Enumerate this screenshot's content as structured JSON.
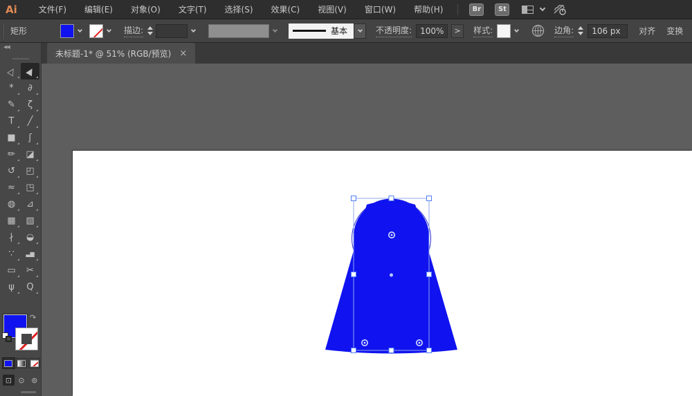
{
  "menubar": {
    "logo": "Ai",
    "items": [
      "文件(F)",
      "编辑(E)",
      "对象(O)",
      "文字(T)",
      "选择(S)",
      "效果(C)",
      "视图(V)",
      "窗口(W)",
      "帮助(H)"
    ],
    "bridge_label": "Br",
    "stock_label": "St"
  },
  "controlbar": {
    "object_label": "矩形",
    "stroke_label": "描边:",
    "brush_name": "基本",
    "opacity_label": "不透明度:",
    "opacity_value": "100%",
    "opacity_expand": ">",
    "style_label": "样式:",
    "corner_label": "边角:",
    "corner_value": "106 px",
    "align_label": "对齐",
    "transform_label": "变换"
  },
  "tab": {
    "title": "未标题-1* @ 51% (RGB/预览)",
    "close": "×"
  },
  "toolbar": {
    "collapse": "◀◀",
    "swap_glyph": "↷",
    "tools": [
      {
        "name": "selection-tool",
        "glyph": "▷"
      },
      {
        "name": "direct-selection-tool",
        "glyph": "▶"
      },
      {
        "name": "magic-wand-tool",
        "glyph": "*"
      },
      {
        "name": "lasso-tool",
        "glyph": "∂"
      },
      {
        "name": "pen-tool",
        "glyph": "✎"
      },
      {
        "name": "curvature-tool",
        "glyph": "ζ"
      },
      {
        "name": "type-tool",
        "glyph": "T"
      },
      {
        "name": "line-segment-tool",
        "glyph": "╱"
      },
      {
        "name": "rectangle-tool",
        "glyph": "■"
      },
      {
        "name": "paintbrush-tool",
        "glyph": "ʃ"
      },
      {
        "name": "shaper-tool",
        "glyph": "✏"
      },
      {
        "name": "eraser-tool",
        "glyph": "◪"
      },
      {
        "name": "rotate-tool",
        "glyph": "↺"
      },
      {
        "name": "scale-tool",
        "glyph": "◰"
      },
      {
        "name": "width-tool",
        "glyph": "≈"
      },
      {
        "name": "free-transform-tool",
        "glyph": "◳"
      },
      {
        "name": "shape-builder-tool",
        "glyph": "◍"
      },
      {
        "name": "perspective-grid-tool",
        "glyph": "⊿"
      },
      {
        "name": "mesh-tool",
        "glyph": "▦"
      },
      {
        "name": "gradient-tool",
        "glyph": "▧"
      },
      {
        "name": "eyedropper-tool",
        "glyph": "∤"
      },
      {
        "name": "blend-tool",
        "glyph": "◒"
      },
      {
        "name": "symbol-sprayer-tool",
        "glyph": "∵"
      },
      {
        "name": "column-graph-tool",
        "glyph": "▃▆"
      },
      {
        "name": "artboard-tool",
        "glyph": "▭"
      },
      {
        "name": "slice-tool",
        "glyph": "✂"
      },
      {
        "name": "hand-tool",
        "glyph": "ψ"
      },
      {
        "name": "zoom-tool",
        "glyph": "Q"
      }
    ],
    "modes": [
      {
        "name": "draw-normal-mode",
        "glyph": "⊡"
      },
      {
        "name": "draw-behind-mode",
        "glyph": "⊙"
      },
      {
        "name": "draw-inside-mode",
        "glyph": "⊚"
      }
    ]
  },
  "colors": {
    "shape_fill": "#1013ef",
    "shape_outline": "#2b2ed0",
    "selection_accent": "#8fa9ef",
    "handle_border": "#4f7df3",
    "stroke_none_red": "#e02020",
    "artboard": "#ffffff",
    "canvas_background": "#5e5e5e",
    "ui_dark": "#2e2e2e",
    "ui_panel": "#474747",
    "logo_orange": "#e08a54"
  }
}
